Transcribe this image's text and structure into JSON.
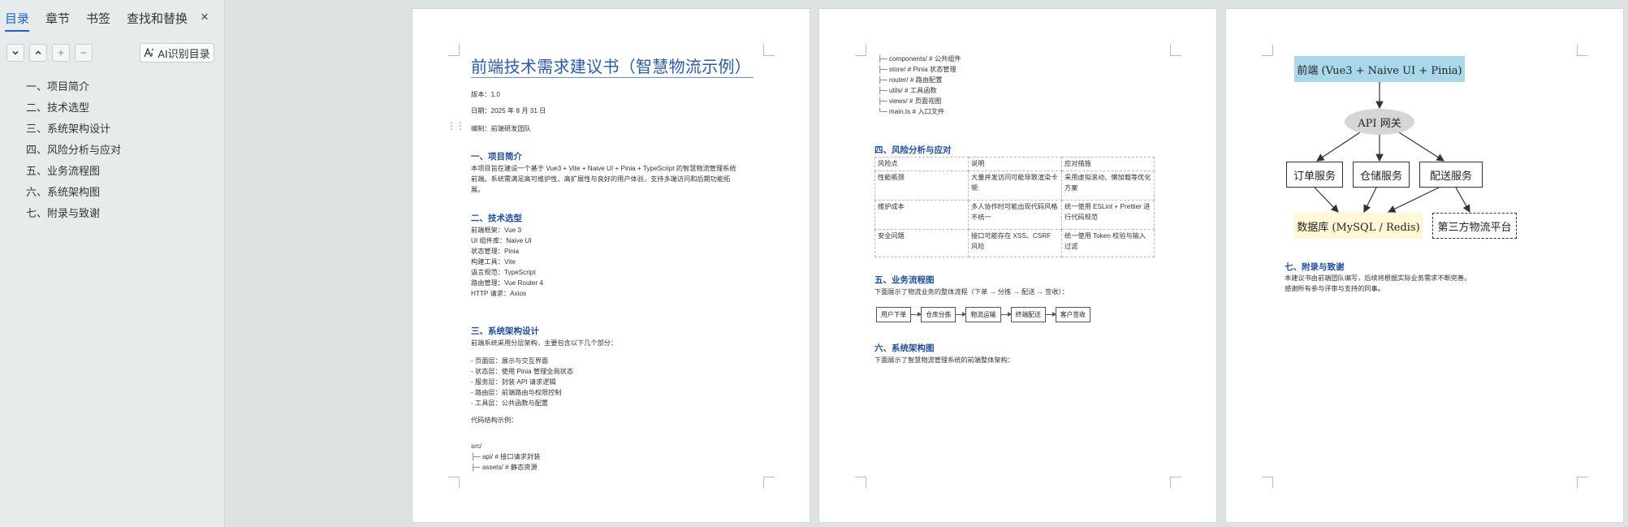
{
  "sidebar": {
    "tabs": [
      "目录",
      "章节",
      "书签",
      "查找和替换"
    ],
    "close_icon": "×",
    "ai_button_label": "AI识别目录",
    "toc_items": [
      "一、项目简介",
      "二、技术选型",
      "三、系统架构设计",
      "四、风险分析与应对",
      "五、业务流程图",
      "六、系统架构图",
      "七、附录与致谢"
    ]
  },
  "page1": {
    "title": "前端技术需求建议书（智慧物流示例）",
    "meta": [
      "版本：1.0",
      "日期：2025 年 8 月 31 日",
      "编制：前端研发团队"
    ],
    "sec1": {
      "heading": "一、项目简介",
      "lines": [
        "本项目旨在建设一个基于 Vue3 + Vite + Naive UI + Pinia + TypeScript 的智慧物流管理系统",
        "前端。系统需满足高可维护性、高扩展性与良好的用户体验，支持多端访问和后期功能拓",
        "展。"
      ]
    },
    "sec2": {
      "heading": "二、技术选型",
      "lines": [
        "前端框架：Vue 3",
        "UI 组件库：Naive UI",
        "状态管理：Pinia",
        "构建工具：Vite",
        "语言规范：TypeScript",
        "路由管理：Vue Router 4",
        "HTTP 请求：Axios"
      ]
    },
    "sec3": {
      "heading": "三、系统架构设计",
      "intro": "前端系统采用分层架构，主要包含以下几个部分：",
      "layers": [
        "- 页面层：展示与交互界面",
        "- 状态层：使用 Pinia 管理全局状态",
        "- 服务层：封装 API 请求逻辑",
        "- 路由层：前端路由与权限控制",
        "- 工具层：公共函数与配置"
      ],
      "code_label": "代码结构示例：",
      "code": [
        "src/",
        "├─ api/        # 接口请求封装",
        "├─ assets/     # 静态资源"
      ]
    }
  },
  "page2": {
    "code": [
      "├─ components/  # 公共组件",
      "├─ store/      # Pinia 状态管理",
      "├─ router/     # 路由配置",
      "├─ utils/      # 工具函数",
      "├─ views/      # 页面视图",
      "└─ main.ts     # 入口文件"
    ],
    "sec4": {
      "heading": "四、风险分析与应对",
      "rows": [
        [
          "风险点",
          "说明",
          "应对措施"
        ],
        [
          "性能瓶颈",
          "大量并发访问可能导致渲染卡顿",
          "采用虚拟滚动、懒加载等优化方案"
        ],
        [
          "维护成本",
          "多人协作时可能出现代码风格不统一",
          "统一使用 ESLint + Prettier 进行代码规范"
        ],
        [
          "安全问题",
          "接口可能存在 XSS、CSRF 风险",
          "统一使用 Token 校验与输入过滤"
        ]
      ]
    },
    "sec5": {
      "heading": "五、业务流程图",
      "intro": "下面展示了物流业务的整体流程（下单 → 分拣 → 配送 → 签收）：",
      "steps": [
        "用户下单",
        "仓库分拣",
        "物流运输",
        "终端配送",
        "客户签收"
      ]
    },
    "sec6": {
      "heading": "六、系统架构图",
      "intro": "下面展示了智慧物流管理系统的前端整体架构："
    }
  },
  "page3": {
    "diagram": {
      "frontend": "前端 (Vue3 + Naive UI + Pinia)",
      "gateway": "API 网关",
      "services": [
        "订单服务",
        "仓储服务",
        "配送服务"
      ],
      "database": "数据库 (MySQL / Redis)",
      "third_party": "第三方物流平台"
    },
    "sec7": {
      "heading": "七、附录与致谢",
      "lines": [
        "本建议书由前端团队编写，后续将根据实际业务需求不断完善。",
        "感谢所有参与评审与支持的同事。"
      ]
    }
  }
}
